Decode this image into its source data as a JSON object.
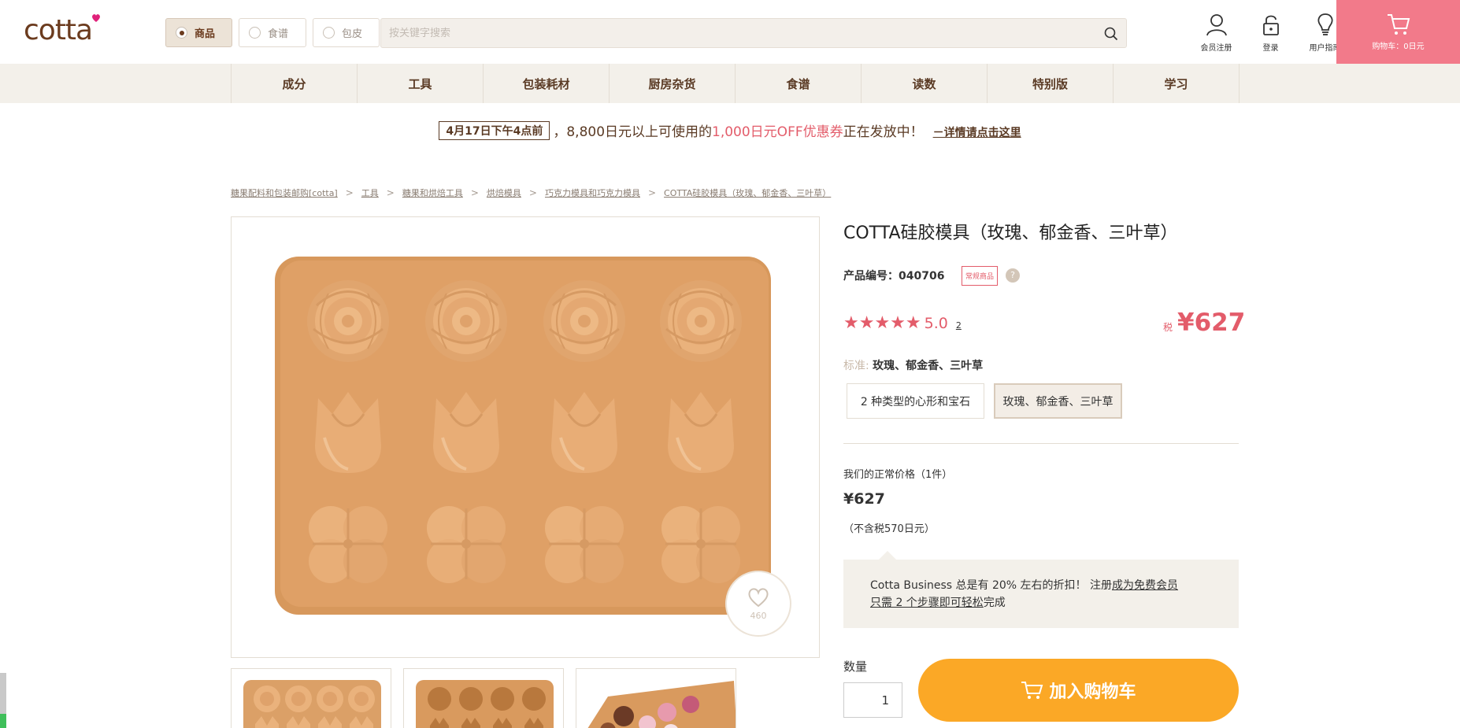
{
  "header": {
    "logo": "cotta",
    "search_tabs": [
      "商品",
      "食谱",
      "包皮"
    ],
    "search_placeholder": "按关键字搜索",
    "icons": [
      {
        "label": "会员注册",
        "icon": "user-icon"
      },
      {
        "label": "登录",
        "icon": "lock-icon"
      },
      {
        "label": "用户指南",
        "icon": "lightbulb-icon"
      }
    ],
    "cart_label": "购物车：0日元"
  },
  "nav": [
    "成分",
    "工具",
    "包装耗材",
    "厨房杂货",
    "食谱",
    "读数",
    "特别版",
    "学习"
  ],
  "promo": {
    "deadline": "4月17日下午4点前",
    "text_a": "，8,800日元以上可使用的",
    "text_highlight": "1,000日元OFF优惠券",
    "text_b": "正在发放中！",
    "detail_link": "－详情请点击这里"
  },
  "breadcrumb": [
    "糖果配料和包装邮购[cotta]",
    "工具",
    "糖果和烘焙工具",
    "烘焙模具",
    "巧克力模具和巧克力模具",
    "COTTA硅胶模具（玫瑰、郁金香、三叶草）"
  ],
  "product": {
    "title": "COTTA硅胶模具（玫瑰、郁金香、三叶草）",
    "code_label": "产品编号：",
    "code": "040706",
    "badge": "常规商品",
    "help": "?",
    "stars": "★★★★★",
    "rating": "5.0",
    "review_count": "2",
    "tax_label": "税",
    "price": "¥627",
    "variant_key": "标准:",
    "variant_value": "玫瑰、郁金香、三叶草",
    "options": [
      "2 种类型的心形和宝石",
      "玫瑰、郁金香、三叶草"
    ],
    "regular_label": "我们的正常价格（1件）",
    "regular_price": "¥627",
    "tax_note": "（不含税570日元）",
    "business_text_a": "Cotta Business 总是有 20% 左右的折扣！ 注册",
    "business_link_a": "成为免费会员",
    "business_link_b": "只需 2 个步骤即可轻松",
    "business_text_b": "完成",
    "qty_label": "数量",
    "qty_value": "1",
    "add_to_cart": "加入购物车",
    "favorites": "460"
  }
}
